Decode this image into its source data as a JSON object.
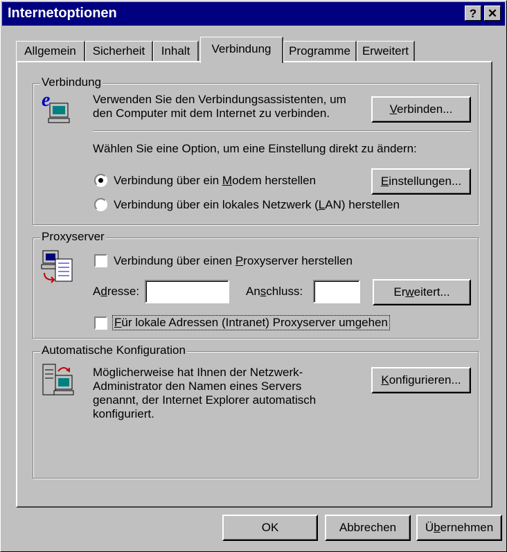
{
  "window": {
    "title": "Internetoptionen",
    "help_glyph": "?",
    "close_glyph": "✕"
  },
  "tabs": [
    {
      "label": "Allgemein",
      "active": false
    },
    {
      "label": "Sicherheit",
      "active": false
    },
    {
      "label": "Inhalt",
      "active": false
    },
    {
      "label": "Verbindung",
      "active": true
    },
    {
      "label": "Programme",
      "active": false
    },
    {
      "label": "Erweitert",
      "active": false
    }
  ],
  "verbindung": {
    "group_title": "Verbindung",
    "description_line1": "Verwenden Sie den Verbindungsassistenten, um",
    "description_line2": "den Computer mit dem Internet zu verbinden.",
    "connect_button": {
      "mnemonic": "V",
      "rest": "erbinden..."
    },
    "option_prompt": "Wählen Sie eine Option, um eine Einstellung direkt zu ändern:",
    "radio_modem": {
      "before": "Verbindung über ein ",
      "mnemonic": "M",
      "after": "odem herstellen",
      "selected": true
    },
    "radio_lan": {
      "before": "Verbindung über ein lokales Netzwerk (",
      "mnemonic": "L",
      "after": "AN) herstellen",
      "selected": false
    },
    "settings_button": {
      "mnemonic": "E",
      "rest": "instellungen..."
    }
  },
  "proxy": {
    "group_title": "Proxyserver",
    "use_proxy": {
      "before": "Verbindung über einen ",
      "mnemonic": "P",
      "after": "roxyserver herstellen",
      "checked": false
    },
    "address_label": {
      "before": "A",
      "mnemonic": "d",
      "after": "resse:"
    },
    "address_value": "",
    "port_label": {
      "before": "An",
      "mnemonic": "s",
      "after": "chluss:"
    },
    "port_value": "",
    "advanced_button": {
      "before": "Er",
      "mnemonic": "w",
      "after": "eitert..."
    },
    "bypass_local": {
      "mnemonic": "F",
      "rest": "ür lokale Adressen (Intranet) Proxyserver umgehen",
      "checked": false
    }
  },
  "auto_config": {
    "group_title": "Automatische Konfiguration",
    "description_line1": "Möglicherweise hat Ihnen der Netzwerk-",
    "description_line2": "Administrator den Namen eines Servers",
    "description_line3": "genannt, der Internet Explorer automatisch",
    "description_line4": "konfiguriert.",
    "configure_button": {
      "mnemonic": "K",
      "rest": "onfigurieren..."
    }
  },
  "footer": {
    "ok_label": "OK",
    "cancel_label": "Abbrechen",
    "apply_button": {
      "before": "Ü",
      "mnemonic": "b",
      "after": "ernehmen"
    }
  }
}
